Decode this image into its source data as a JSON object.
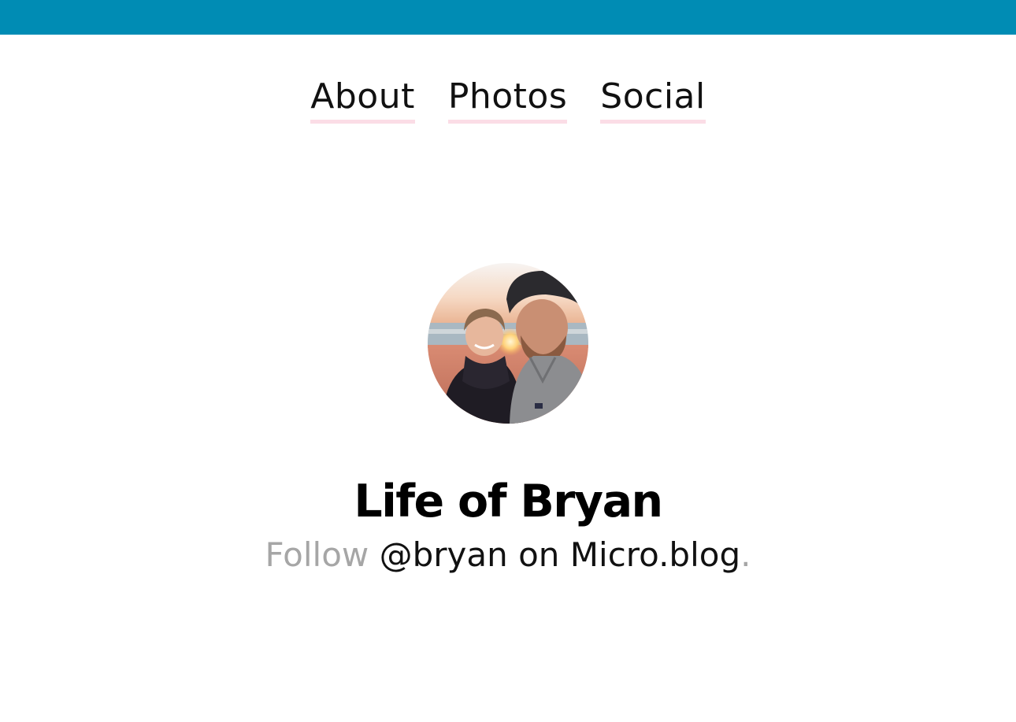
{
  "header": {
    "bar_color": "#008cb4"
  },
  "nav": {
    "items": [
      {
        "label": "About"
      },
      {
        "label": "Photos"
      },
      {
        "label": "Social"
      }
    ],
    "underline_color": "#fbdde6"
  },
  "profile": {
    "avatar_alt": "photo-of-couple-at-beach-sunset"
  },
  "site": {
    "title": "Life of Bryan",
    "follow_prefix": "Follow",
    "follow_link": "@bryan on Micro.blog",
    "follow_suffix": "."
  }
}
